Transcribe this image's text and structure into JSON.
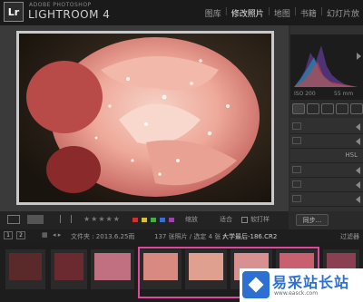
{
  "app": {
    "logo": "Lr",
    "brand_sub": "ADOBE PHOTOSHOP",
    "brand_name": "LIGHTROOM 4"
  },
  "modules": [
    {
      "label": "图库",
      "active": false
    },
    {
      "label": "修改照片",
      "active": true
    },
    {
      "label": "地图",
      "active": false
    },
    {
      "label": "书籍",
      "active": false
    },
    {
      "label": "幻灯片放",
      "active": false
    }
  ],
  "histogram": {
    "iso": "ISO 200",
    "focal": "55 mm"
  },
  "right_panels": {
    "hsl_label": "HSL"
  },
  "toolbar": {
    "stars": "★★★★★",
    "zoom_label": "缩放",
    "fit_label": "适合",
    "compare_label": "软打样",
    "sync_button": "同步...",
    "colors": [
      "#d23030",
      "#d8c030",
      "#40b040",
      "#3070d8",
      "#a040b0"
    ]
  },
  "filter": {
    "page1": "1",
    "page2": "2",
    "path": "文件夹 : 2013.6.25雨",
    "count": "137 张照片 / 选定 4 张 /",
    "filename": "大学最后-186.CR2",
    "filter_label": "过滤器"
  },
  "watermark": {
    "text": "易采站长站",
    "url": "www.easck.com"
  }
}
